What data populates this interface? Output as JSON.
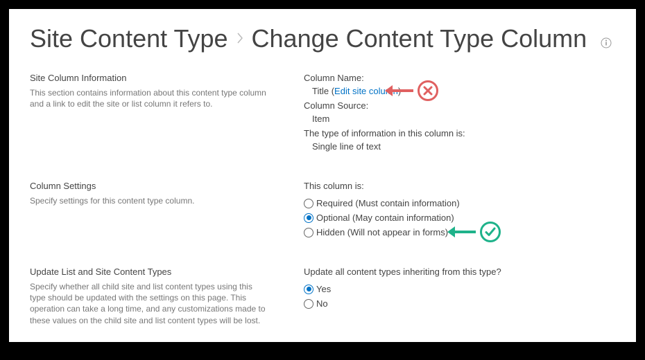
{
  "header": {
    "part1": "Site Content Type",
    "part2": "Change Content Type Column"
  },
  "sections": {
    "info": {
      "heading": "Site Column Information",
      "desc": "This section contains information about this content type column and a link to edit the site or list column it refers to."
    },
    "settings": {
      "heading": "Column Settings",
      "desc": "Specify settings for this content type column."
    },
    "inherit": {
      "heading": "Update List and Site Content Types",
      "desc": "Specify whether all child site and list content types using this type should be updated with the settings on this page. This operation can take a long time, and any customizations made to these values on the child site and list content types will be lost."
    }
  },
  "fields": {
    "columnNameLabel": "Column Name:",
    "columnNameValue": "Title",
    "editLink": "Edit site column",
    "columnSourceLabel": "Column Source:",
    "columnSourceValue": "Item",
    "columnTypeLabel": "The type of information in this column is:",
    "columnTypeValue": "Single line of text"
  },
  "settings": {
    "prompt": "This column is:",
    "options": {
      "required": "Required (Must contain information)",
      "optional": "Optional (May contain information)",
      "hidden": "Hidden (Will not appear in forms)"
    }
  },
  "inherit": {
    "prompt": "Update all content types inheriting from this type?",
    "yes": "Yes",
    "no": "No"
  }
}
